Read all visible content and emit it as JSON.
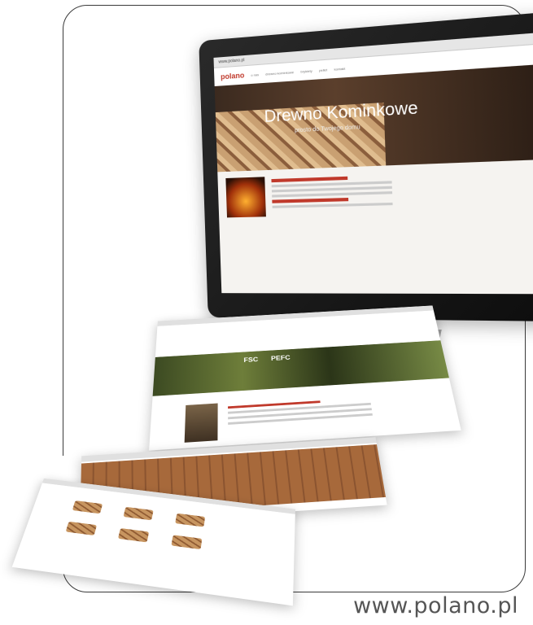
{
  "screen": {
    "browser_url": "www.polano.pl",
    "logo": "polano",
    "nav": [
      "o nas",
      "drewno kominkowe",
      "brykiety",
      "pellet",
      "kontakt"
    ],
    "hero_title": "Drewno Kominkowe",
    "hero_subtitle": "prosto do Twojego domu"
  },
  "pages": {
    "cert_labels": [
      "FSC",
      "PEFC"
    ]
  },
  "footer": {
    "url": "www.polano.pl"
  }
}
